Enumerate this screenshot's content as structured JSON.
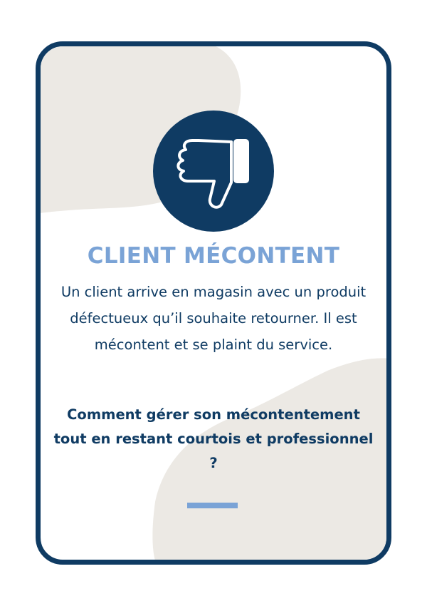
{
  "card": {
    "title": "CLIENT MÉCONTENT",
    "description": "Un client arrive en magasin avec un produit défectueux qu’il souhaite retourner. Il est mécontent et se plaint du service.",
    "question": "Comment gérer son mécontentement tout en restant courtois et professionnel ?",
    "icon": "thumbs-down-icon"
  },
  "colors": {
    "border": "#0f3b63",
    "title": "#7aa3d6",
    "text": "#0f3b63",
    "blob": "#ece9e4",
    "divider": "#7aa3d6"
  }
}
